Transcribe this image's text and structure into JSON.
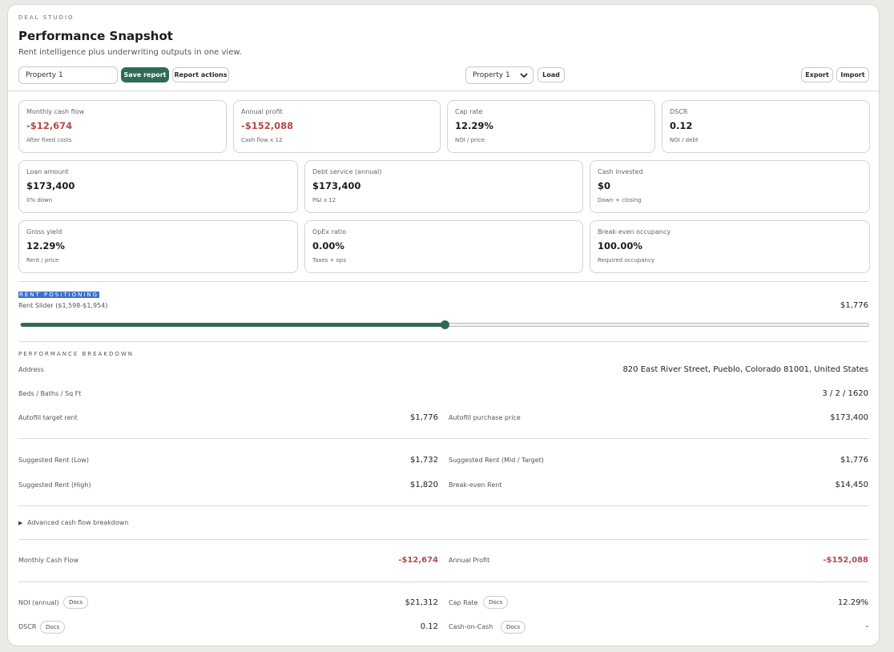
{
  "header": {
    "eyebrow": "DEAL STUDIO",
    "title": "Performance Snapshot",
    "subtitle": "Rent intelligence plus underwriting outputs in one view."
  },
  "toolbar": {
    "report_name_value": "Property 1",
    "save_label": "Save report",
    "report_actions_label": "Report actions",
    "property_select_value": "Property 1",
    "load_label": "Load",
    "export_label": "Export",
    "import_label": "Import"
  },
  "metrics": {
    "monthly_cash_flow": {
      "label": "Monthly cash flow",
      "value": "-$12,674",
      "note": "After fixed costs"
    },
    "annual_profit": {
      "label": "Annual profit",
      "value": "-$152,088",
      "note": "Cash flow x 12"
    },
    "cap_rate": {
      "label": "Cap rate",
      "value": "12.29%",
      "note": "NOI / price"
    },
    "dscr": {
      "label": "DSCR",
      "value": "0.12",
      "note": "NOI / debt"
    },
    "loan_amount": {
      "label": "Loan amount",
      "value": "$173,400",
      "note": "0% down"
    },
    "debt_service": {
      "label": "Debt service (annual)",
      "value": "$173,400",
      "note": "P&I x 12"
    },
    "cash_invested": {
      "label": "Cash invested",
      "value": "$0",
      "note": "Down + closing"
    },
    "gross_yield": {
      "label": "Gross yield",
      "value": "12.29%",
      "note": "Rent / price"
    },
    "opex_ratio": {
      "label": "OpEx ratio",
      "value": "0.00%",
      "note": "Taxes + ops"
    },
    "breakeven_occupancy": {
      "label": "Break-even occupancy",
      "value": "100.00%",
      "note": "Required occupancy"
    }
  },
  "rent_positioning": {
    "section_label": "RENT POSITIONING",
    "slider_label": "Rent Slider ($1,598-$1,954)",
    "slider_value": "$1,776",
    "slider_fraction": 0.5
  },
  "breakdown": {
    "section_label": "PERFORMANCE BREAKDOWN",
    "address_label": "Address",
    "address_value": "820 East River Street, Pueblo, Colorado 81001, United States",
    "beds_label": "Beds / Baths / Sq Ft",
    "beds_value": "3 / 2 / 1620",
    "autofill_rent_label": "Autofill target rent",
    "autofill_rent_value": "$1,776",
    "autofill_price_label": "Autofill purchase price",
    "autofill_price_value": "$173,400",
    "sugg_low_label": "Suggested Rent (Low)",
    "sugg_low_value": "$1,732",
    "sugg_mid_label": "Suggested Rent (Mid / Target)",
    "sugg_mid_value": "$1,776",
    "sugg_high_label": "Suggested Rent (High)",
    "sugg_high_value": "$1,820",
    "breakeven_rent_label": "Break-even Rent",
    "breakeven_rent_value": "$14,450",
    "advanced_label": "Advanced cash flow breakdown",
    "monthly_cf_label": "Monthly Cash Flow",
    "monthly_cf_value": "-$12,674",
    "annual_profit_label": "Annual Profit",
    "annual_profit_value": "-$152,088",
    "noi_label": "NOI (annual)",
    "noi_value": "$21,312",
    "cap_rate_label": "Cap Rate",
    "cap_rate_value": "12.29%",
    "dscr_label": "DSCR",
    "dscr_value": "0.12",
    "coc_label": "Cash-on-Cash",
    "coc_value": "-",
    "docs_label": "Docs"
  },
  "colors": {
    "accent": "#2f6b55",
    "negative": "#b24a4a",
    "highlight": "#3c6fd0"
  }
}
